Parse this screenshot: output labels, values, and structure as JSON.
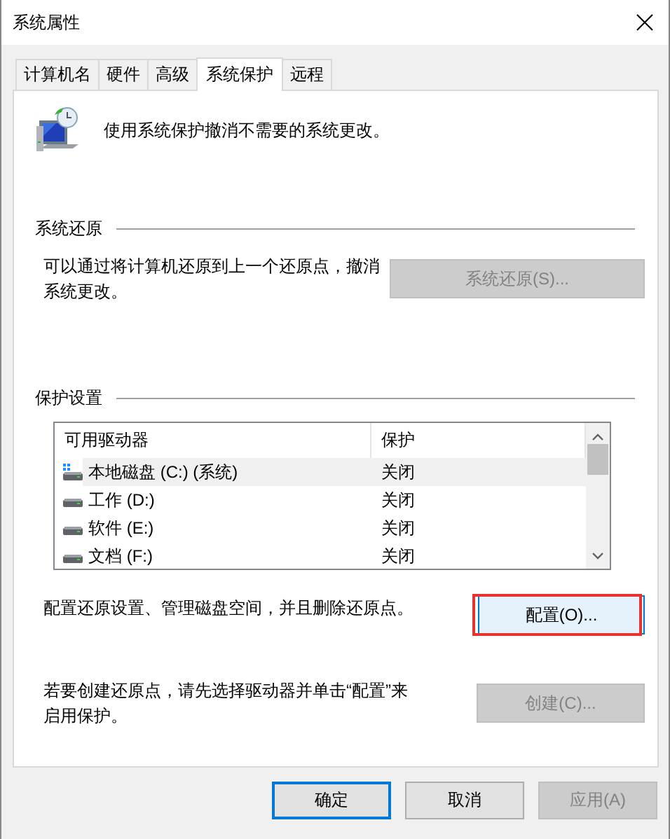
{
  "window": {
    "title": "系统属性"
  },
  "tabs": [
    {
      "label": "计算机名",
      "selected": false
    },
    {
      "label": "硬件",
      "selected": false
    },
    {
      "label": "高级",
      "selected": false
    },
    {
      "label": "系统保护",
      "selected": true
    },
    {
      "label": "远程",
      "selected": false
    }
  ],
  "intro": {
    "text": "使用系统保护撤消不需要的系统更改。"
  },
  "restore": {
    "label": "系统还原",
    "description": "可以通过将计算机还原到上一个还原点，撤消系统更改。",
    "button": {
      "label": "系统还原(S)...",
      "disabled": true,
      "highlighted": false
    }
  },
  "protection": {
    "label": "保护设置",
    "table": {
      "columns": [
        "可用驱动器",
        "保护"
      ],
      "rows": [
        {
          "kind": "system",
          "name": "本地磁盘 (C:) (系统)",
          "protection": "关闭",
          "selected": true
        },
        {
          "kind": "drive",
          "name": "工作 (D:)",
          "protection": "关闭",
          "selected": false
        },
        {
          "kind": "drive",
          "name": "软件 (E:)",
          "protection": "关闭",
          "selected": false
        },
        {
          "kind": "drive",
          "name": "文档 (F:)",
          "protection": "关闭",
          "selected": false
        }
      ]
    },
    "configure": {
      "description": "配置还原设置、管理磁盘空间，并且删除还原点。",
      "button": {
        "label": "配置(O)...",
        "disabled": false,
        "highlighted": true
      }
    },
    "create": {
      "description": "若要创建还原点，请先选择驱动器并单击“配置”来启用保护。",
      "button": {
        "label": "创建(C)...",
        "disabled": true,
        "highlighted": false
      }
    }
  },
  "footer_buttons": [
    {
      "label": "确定",
      "default": true,
      "disabled": false
    },
    {
      "label": "取消",
      "default": false,
      "disabled": false
    },
    {
      "label": "应用(A)",
      "default": false,
      "disabled": true
    }
  ]
}
